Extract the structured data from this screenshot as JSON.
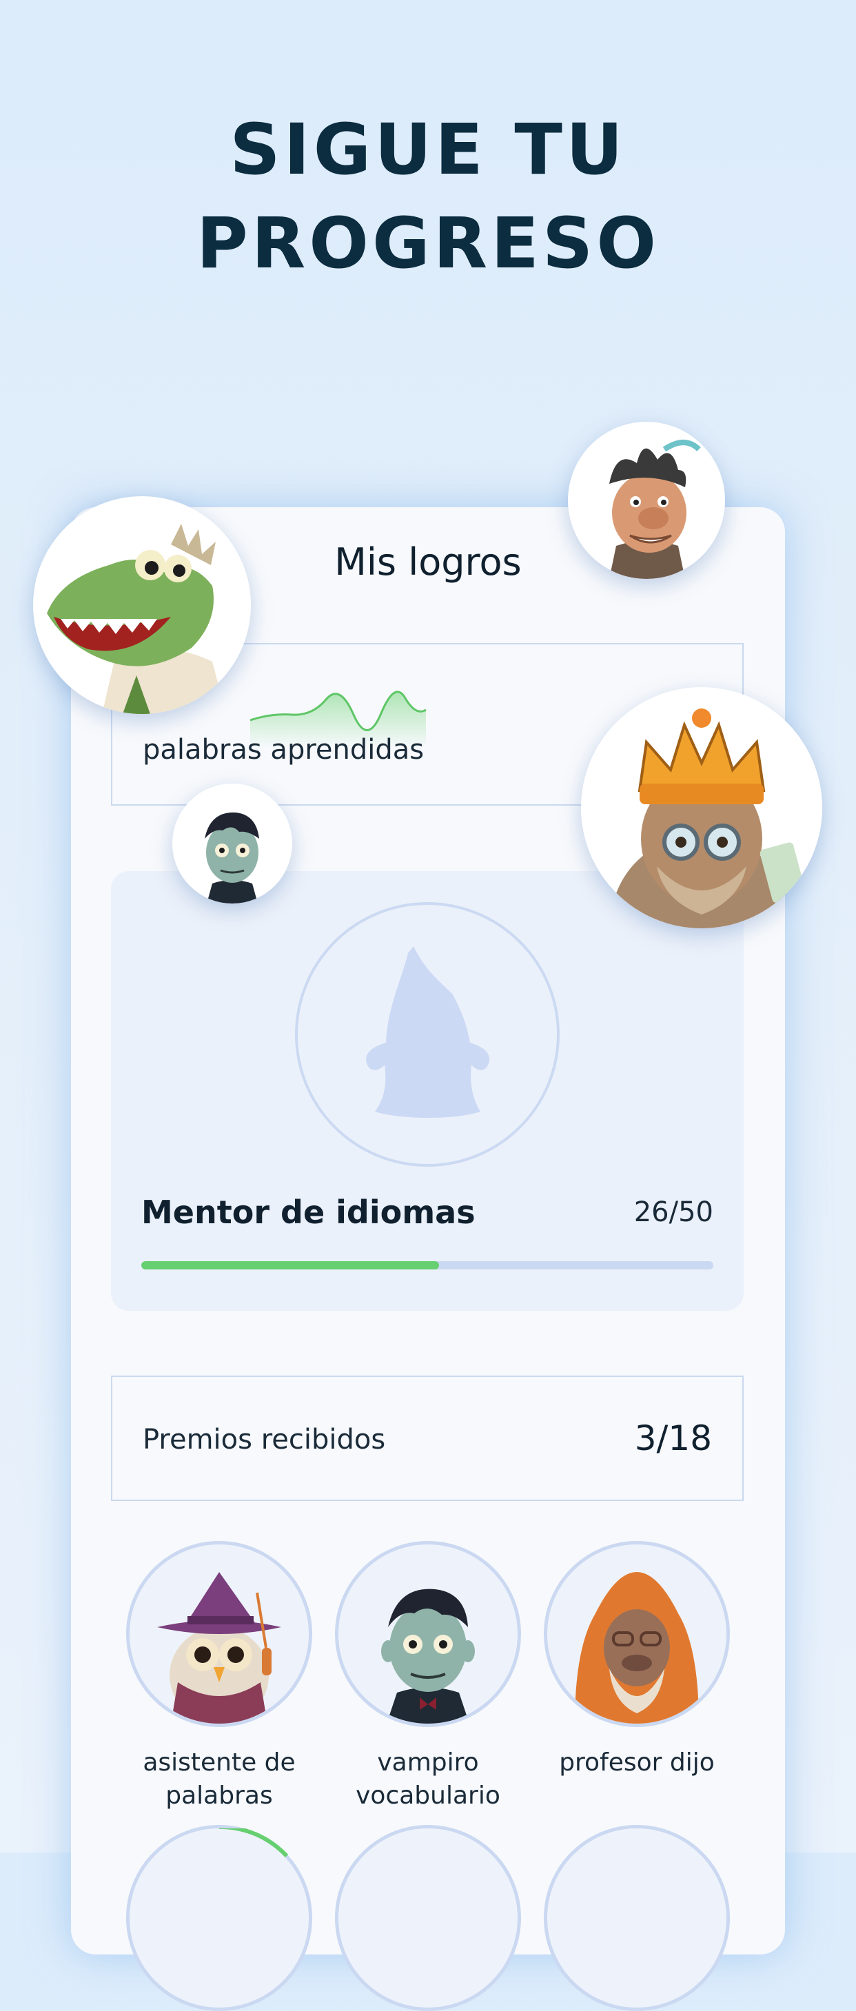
{
  "headline": {
    "line1": "SIGUE TU",
    "line2": "PROGRESO"
  },
  "card": {
    "title": "Mis logros",
    "words": {
      "label": "palabras aprendidas"
    },
    "mentor": {
      "name": "Mentor de idiomas",
      "count": "26/50",
      "progress": 0.52
    },
    "awards": {
      "label": "Premios recibidos",
      "count": "3/18"
    },
    "badges": [
      {
        "label": "asistente de\npalabras",
        "icon": "owl-wizard-icon"
      },
      {
        "label": "vampiro\nvocabulario",
        "icon": "vampire-icon"
      },
      {
        "label": "profesor dijo",
        "icon": "ape-professor-icon"
      }
    ]
  },
  "colors": {
    "headline": "#0c2c40",
    "progress_fill": "#66cf6f",
    "progress_track": "#cbd8f1",
    "ring": "#cbd9f2"
  },
  "floating_avatars": [
    "crocodile-icon",
    "caveman-icon",
    "king-ape-icon",
    "vampire-small-icon"
  ]
}
